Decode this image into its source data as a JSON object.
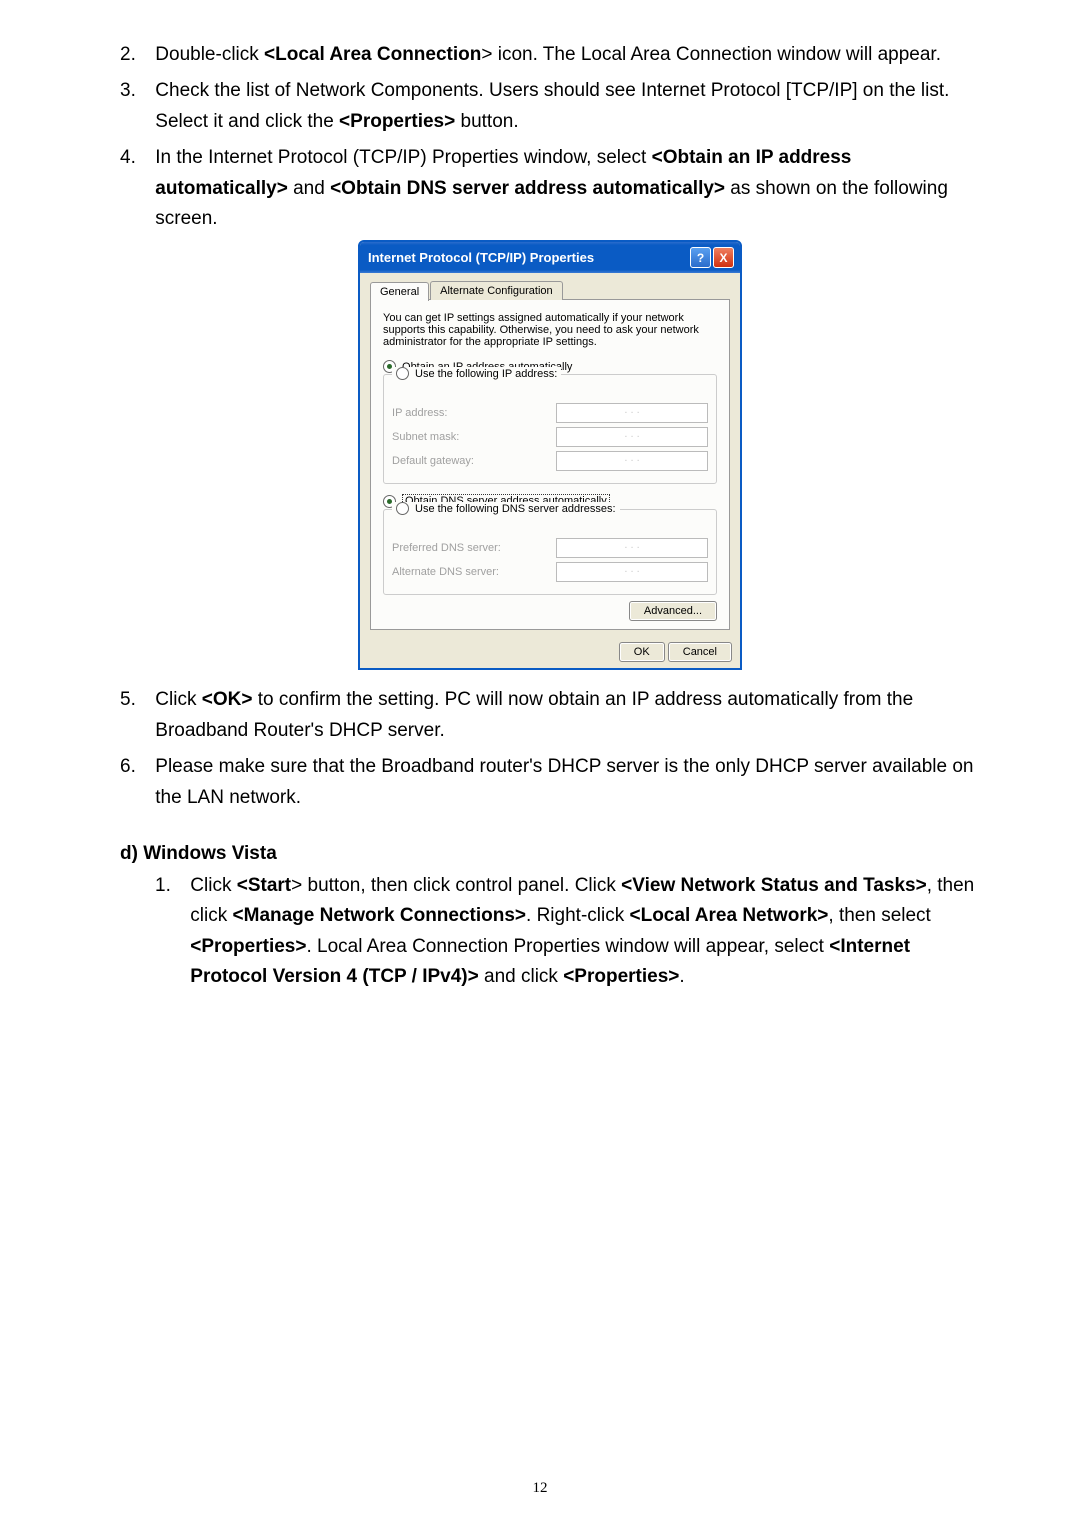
{
  "steps_a": [
    {
      "num": "2.",
      "parts": [
        "Double-click ",
        {
          "b": "<Local Area Connection"
        },
        "> icon. The Local Area Connection window will appear."
      ]
    },
    {
      "num": "3.",
      "parts": [
        "Check the list of Network Components. Users should see Internet Protocol [TCP/IP] on the list. Select it and click the ",
        {
          "b": "<Properties>"
        },
        " button."
      ]
    },
    {
      "num": "4.",
      "parts": [
        "In the Internet Protocol (TCP/IP) Properties window, select ",
        {
          "b": "<Obtain an IP address automatically>"
        },
        " and ",
        {
          "b": "<Obtain DNS server address automatically>"
        },
        " as shown on the following screen."
      ]
    }
  ],
  "dialog": {
    "title": "Internet Protocol (TCP/IP) Properties",
    "help": "?",
    "close": "X",
    "tabs": {
      "general": "General",
      "alt": "Alternate Configuration"
    },
    "intro": "You can get IP settings assigned automatically if your network supports this capability. Otherwise, you need to ask your network administrator for the appropriate IP settings.",
    "radio_obtain_ip_pre": "O",
    "radio_obtain_ip_rest": "btain an IP address automatically",
    "radio_use_ip_pre": "Us",
    "radio_use_ip_rest": "e the following IP address:",
    "ip_addr_label_pre": "I",
    "ip_addr_label_rest": "P address:",
    "subnet_label_pre": "S",
    "subnet_label_rest": "ubnet mask:",
    "gateway_label_pre": "D",
    "gateway_label_rest": "efault gateway:",
    "radio_obtain_dns_pre": "Obtain DNS server address automatically",
    "radio_use_dns_pre": "Us",
    "radio_use_dns_rest": "e the following DNS server addresses:",
    "pref_dns_pre": "P",
    "pref_dns_rest": "referred DNS server:",
    "alt_dns_pre": "A",
    "alt_dns_rest": "lternate DNS server:",
    "advanced_btn_pre": "Ad",
    "advanced_btn_rest": "vanced...",
    "ok_btn": "OK",
    "cancel_btn": "Cancel",
    "dots": ".       .       ."
  },
  "steps_b": [
    {
      "num": "5.",
      "parts": [
        "Click ",
        {
          "b": "<OK>"
        },
        " to confirm the setting. PC will now obtain an IP address automatically from the Broadband Router's DHCP server."
      ]
    },
    {
      "num": "6.",
      "parts": [
        "Please make sure that the Broadband router's DHCP server is the only DHCP server available on the LAN network."
      ]
    }
  ],
  "section_d": "d)  Windows Vista",
  "vista_step": {
    "num": "1.",
    "parts": [
      "Click ",
      {
        "b": "<Start"
      },
      "> button, then click control panel. Click ",
      {
        "b": "<View Network Status and Tasks>"
      },
      ", then click ",
      {
        "b": "<Manage Network Connections>"
      },
      ". Right-click ",
      {
        "b": "<Local Area Network>"
      },
      ", then select ",
      {
        "b": "<Properties>"
      },
      ". Local Area Connection Properties window will appear, select ",
      {
        "b": "<Internet Protocol Version 4 (TCP / IPv4)>"
      },
      " and click ",
      {
        "b": "<Properties>"
      },
      "."
    ]
  },
  "page_num": "12"
}
